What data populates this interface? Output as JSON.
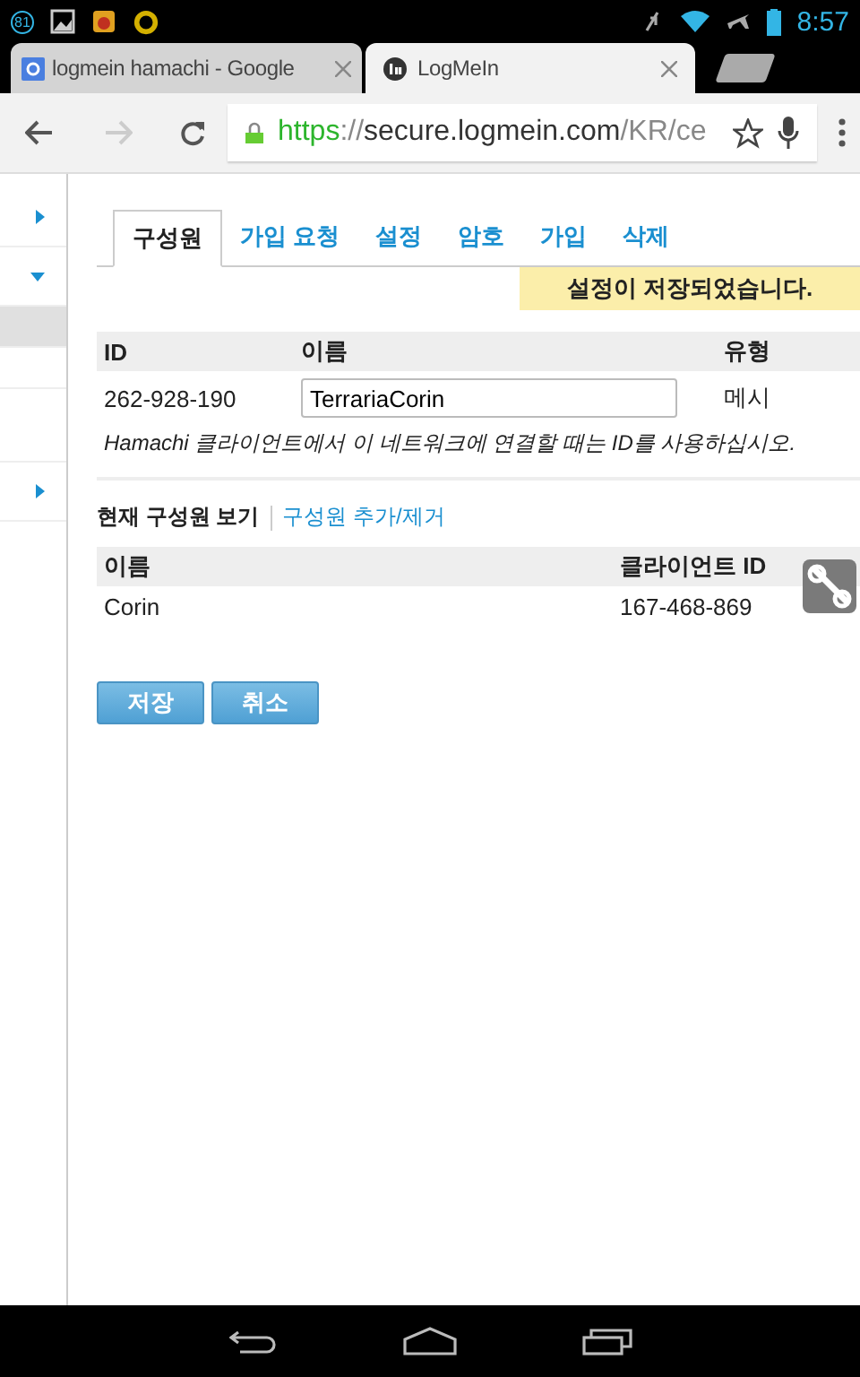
{
  "status_bar": {
    "notification_count": "81",
    "time": "8:57"
  },
  "browser_tabs": [
    {
      "title": "logmein hamachi - Google",
      "selected": false,
      "kind": "google"
    },
    {
      "title": "LogMeIn",
      "selected": true,
      "kind": "logmein"
    }
  ],
  "address_bar": {
    "scheme": "https",
    "separator": "://",
    "host": "secure.logmein.com",
    "path": "/KR/ce"
  },
  "sidebar": {
    "items": [
      {
        "expanded": false
      },
      {
        "expanded": true,
        "children": [
          {
            "selected": true
          },
          {
            "selected": false
          }
        ]
      },
      {
        "expanded": false
      }
    ]
  },
  "tabs": [
    {
      "label": "구성원",
      "selected": true
    },
    {
      "label": "가입 요청",
      "selected": false
    },
    {
      "label": "설정",
      "selected": false
    },
    {
      "label": "암호",
      "selected": false
    },
    {
      "label": "가입",
      "selected": false
    },
    {
      "label": "삭제",
      "selected": false
    }
  ],
  "notice": "설정이 저장되었습니다.",
  "network_table": {
    "columns": [
      "ID",
      "이름",
      "유형"
    ],
    "rows": [
      {
        "id": "262-928-190",
        "name": "TerrariaCorin",
        "type": "메시"
      }
    ],
    "hint": "Hamachi 클라이언트에서 이 네트워크에 연결할 때는 ID를 사용하십시오."
  },
  "member_views": [
    {
      "label": "현재 구성원 보기",
      "selected": true
    },
    {
      "label": "구성원 추가/제거",
      "selected": false
    }
  ],
  "member_table": {
    "columns": [
      "이름",
      "클라이언트 ID"
    ],
    "rows": [
      {
        "name": "Corin",
        "client_id": "167-468-869"
      }
    ]
  },
  "buttons": [
    "저장",
    "취소"
  ]
}
